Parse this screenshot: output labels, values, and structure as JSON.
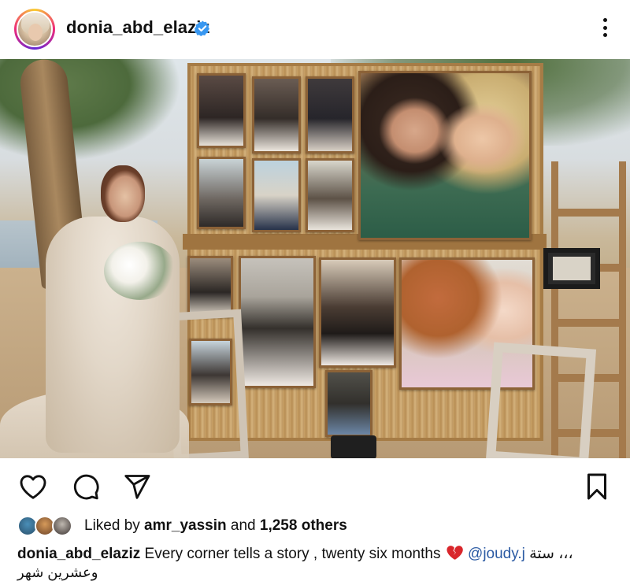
{
  "header": {
    "username": "donia_abd_elaziz",
    "verified": true,
    "avatar_icon": "profile-avatar",
    "more_icon": "three-dots-vertical-icon"
  },
  "post": {
    "image_description_icon": "photo-content"
  },
  "actions": {
    "like_icon": "heart-outline-icon",
    "comment_icon": "speech-bubble-icon",
    "share_icon": "paper-plane-icon",
    "save_icon": "bookmark-outline-icon"
  },
  "likes": {
    "prefix": "Liked by ",
    "user": "amr_yassin",
    "middle": " and ",
    "count": "1,258 others"
  },
  "caption": {
    "username": "donia_abd_elaziz",
    "text": " Every corner tells a story , twenty six months ",
    "emoji": "broken-heart",
    "mention": "@joudy.j",
    "arabic_1": " ستة ،،،",
    "arabic_2": "وعشرين شهر"
  },
  "colors": {
    "verified_blue": "#3897f0",
    "mention_blue": "#2b5aa3",
    "broken_heart_red": "#d9262b",
    "text": "#111111"
  }
}
